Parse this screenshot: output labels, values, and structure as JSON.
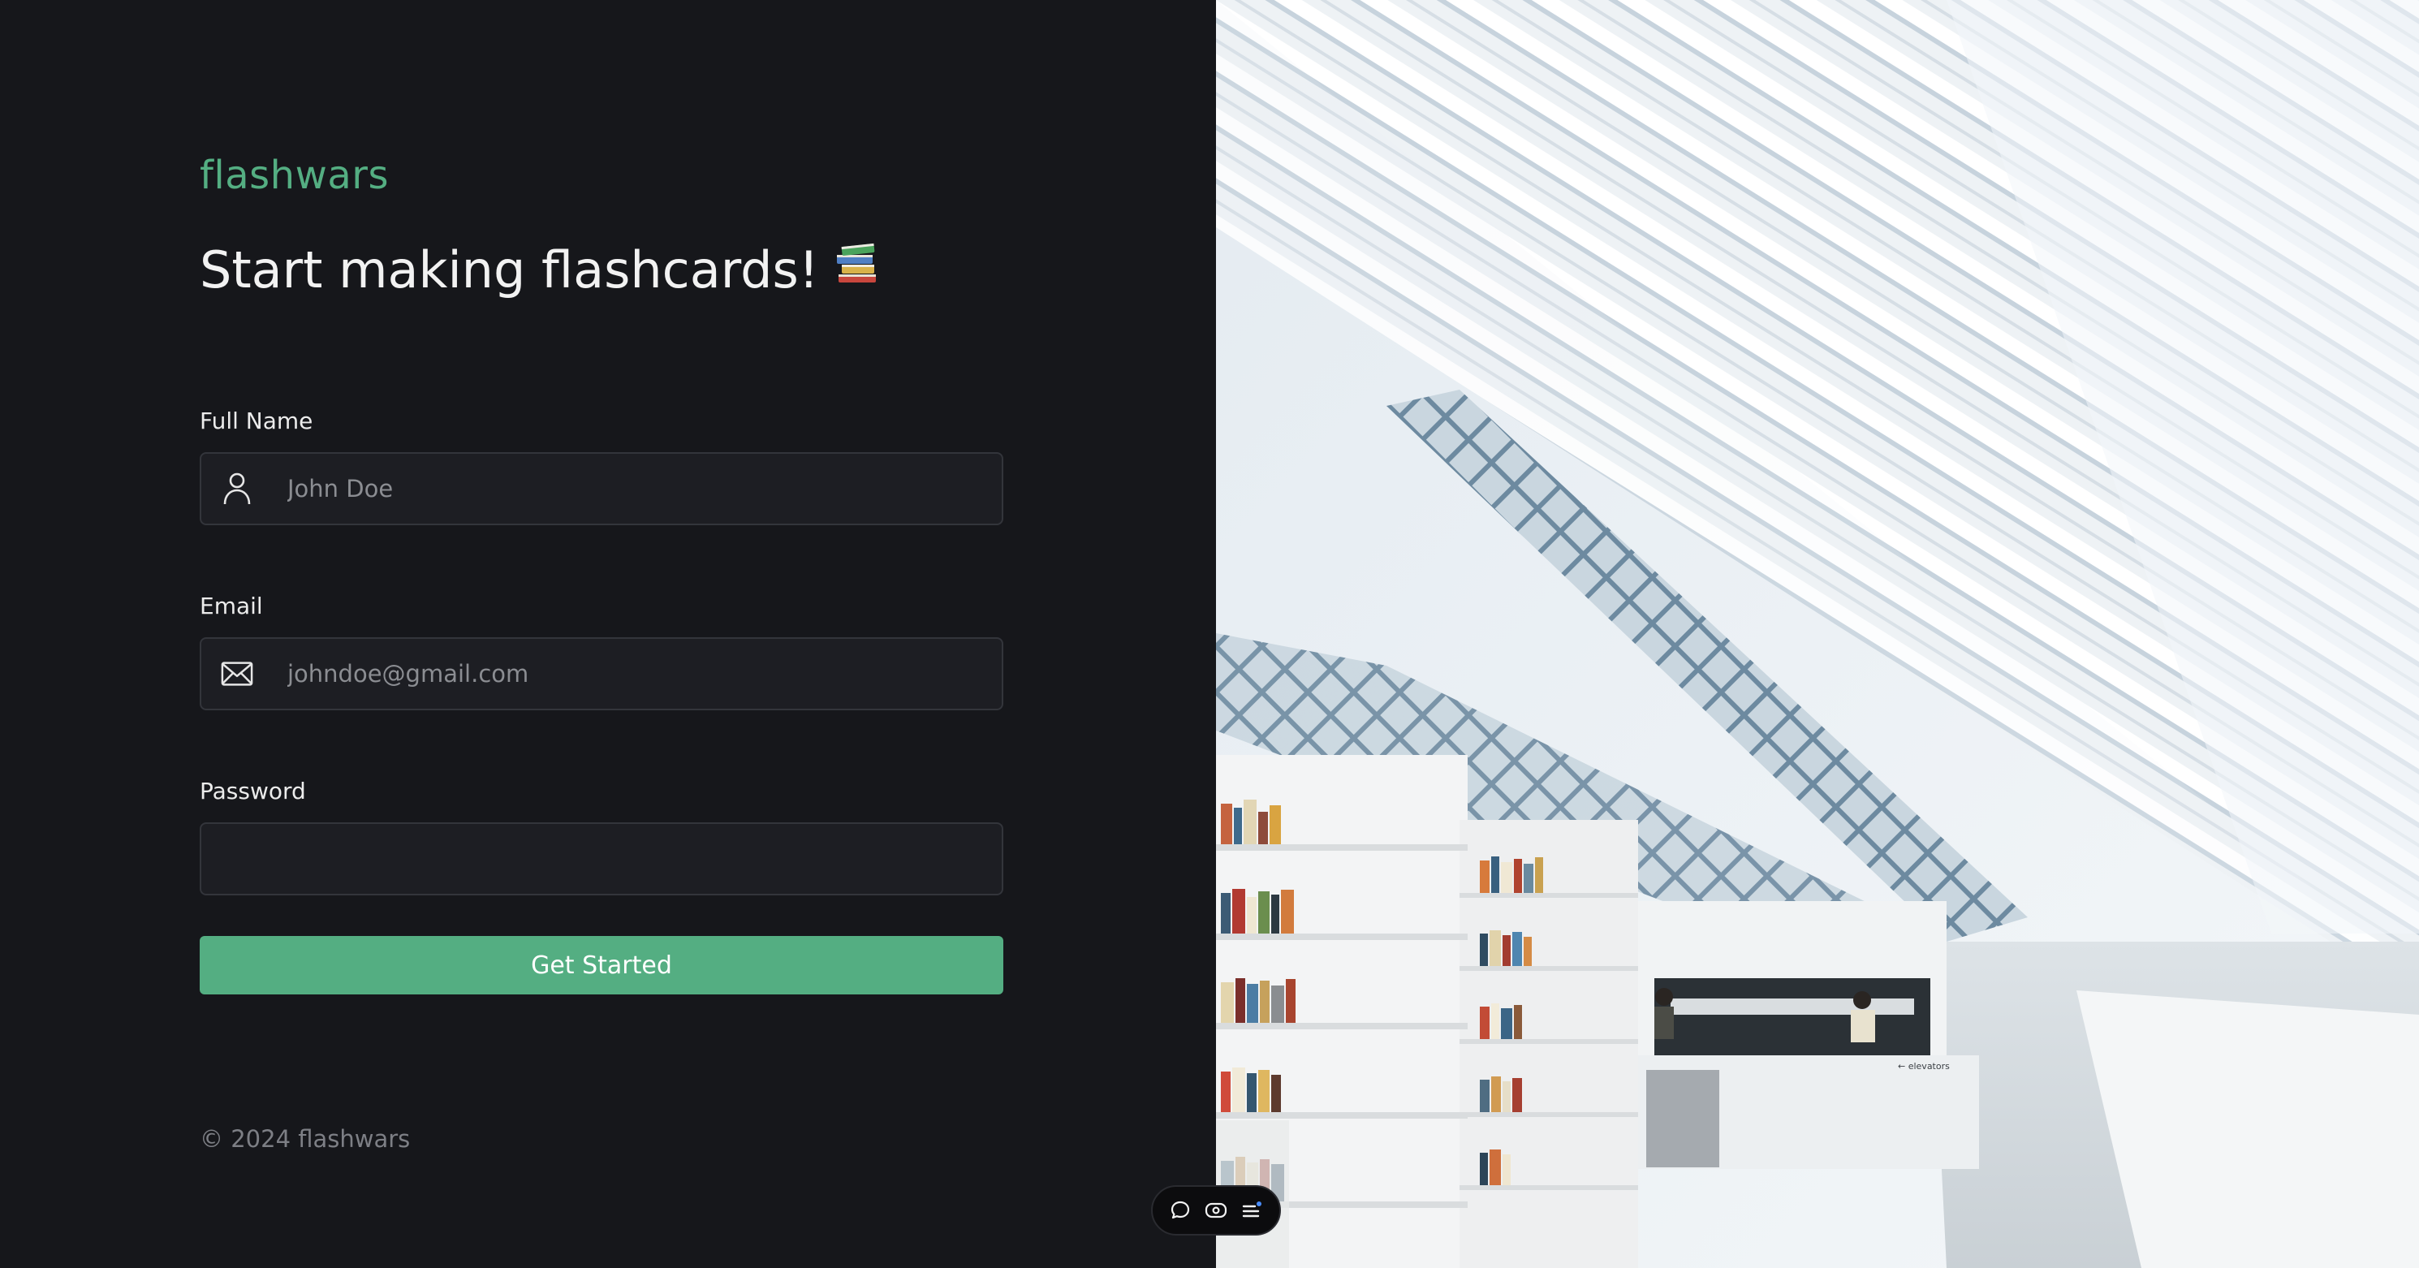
{
  "brand": {
    "name": "flashwars"
  },
  "headline": {
    "text": "Start making flashcards!",
    "emoji": "books-emoji"
  },
  "form": {
    "full_name": {
      "label": "Full Name",
      "placeholder": "John Doe",
      "value": "",
      "icon": "user-icon"
    },
    "email": {
      "label": "Email",
      "placeholder": "johndoe@gmail.com",
      "value": "",
      "icon": "mail-icon"
    },
    "password": {
      "label": "Password",
      "placeholder": "",
      "value": ""
    },
    "submit_label": "Get Started"
  },
  "footer": {
    "copyright": "© 2024 flashwars"
  },
  "hero_image": {
    "subject": "library-interior-photo",
    "sign_text": "← elevators"
  },
  "toolbar": {
    "icons": [
      "comment-icon",
      "eye-icon",
      "menu-icon"
    ]
  },
  "colors": {
    "background": "#16171b",
    "accent": "#54ae82",
    "input_bg": "#1d1e23",
    "input_border": "#33353b",
    "muted_text": "#7d7f85"
  }
}
